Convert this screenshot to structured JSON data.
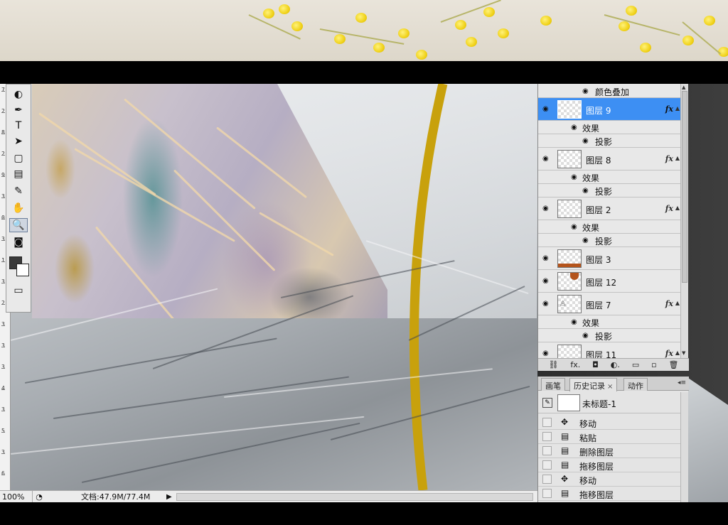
{
  "status_bar": {
    "zoom": "100%",
    "doc_size": "文档:47.9M/77.4M"
  },
  "tools": [
    {
      "icon": "lasso-icon",
      "glyph": "◐"
    },
    {
      "icon": "pen-icon",
      "glyph": "✒"
    },
    {
      "icon": "type-icon",
      "glyph": "T"
    },
    {
      "icon": "path-selection-icon",
      "glyph": "➤"
    },
    {
      "icon": "rectangle-shape-icon",
      "glyph": "▢"
    },
    {
      "icon": "notes-icon",
      "glyph": "▤"
    },
    {
      "icon": "eyedropper-icon",
      "glyph": "✎"
    },
    {
      "icon": "hand-icon",
      "glyph": "✋"
    },
    {
      "icon": "zoom-icon",
      "glyph": "🔍"
    },
    {
      "icon": "quick-mask-icon",
      "glyph": "◙"
    },
    {
      "icon": "screen-mode-icon",
      "glyph": "▭"
    }
  ],
  "ruler_labels": [
    "7",
    "2",
    "8",
    "2",
    "9",
    "3",
    "0",
    "3",
    "1",
    "3",
    "2",
    "3",
    "3",
    "3",
    "4",
    "3",
    "5",
    "3",
    "6"
  ],
  "layers": {
    "top_effect": "颜色叠加",
    "items": [
      {
        "name": "图层 9",
        "selected": true,
        "fx": "fx",
        "effects_label": "效果",
        "effect": "投影"
      },
      {
        "name": "图层 8",
        "selected": false,
        "fx": "fx",
        "effects_label": "效果",
        "effect": "投影"
      },
      {
        "name": "图层 2",
        "selected": false,
        "fx": "fx",
        "effects_label": "效果",
        "effect": "投影"
      },
      {
        "name": "图层 3",
        "selected": false
      },
      {
        "name": "图层 12",
        "selected": false
      },
      {
        "name": "图层 7",
        "selected": false,
        "fx": "fx",
        "effects_label": "效果",
        "effect": "投影"
      },
      {
        "name": "图层 11",
        "selected": false,
        "fx": "fx"
      }
    ],
    "toolbar_icons": [
      "link-icon",
      "fx-icon",
      "mask-icon",
      "adjustment-icon",
      "folder-icon",
      "new-layer-icon",
      "trash-icon"
    ],
    "toolbar_glyphs": [
      "⛓",
      "fx.",
      "◘",
      "◐.",
      "▭",
      "▫",
      "🗑"
    ]
  },
  "history": {
    "tabs": [
      {
        "label": "画笔",
        "active": false
      },
      {
        "label": "历史记录",
        "active": true,
        "close": "×"
      },
      {
        "label": "动作",
        "active": false
      }
    ],
    "snapshot": "未标题-1",
    "steps": [
      {
        "label": "移动",
        "icon": "move-tool-icon",
        "glyph": "✥"
      },
      {
        "label": "粘贴",
        "icon": "document-icon",
        "glyph": "▤"
      },
      {
        "label": "删除图层",
        "icon": "document-icon",
        "glyph": "▤"
      },
      {
        "label": "拖移图层",
        "icon": "document-icon",
        "glyph": "▤"
      },
      {
        "label": "移动",
        "icon": "move-tool-icon",
        "glyph": "✥"
      },
      {
        "label": "拖移图层",
        "icon": "document-icon",
        "glyph": "▤"
      }
    ]
  },
  "colors": {
    "selection": "#3d8ff3",
    "gold_arc": "#c8a10c",
    "thumbnail_fill": "#b4541c"
  }
}
